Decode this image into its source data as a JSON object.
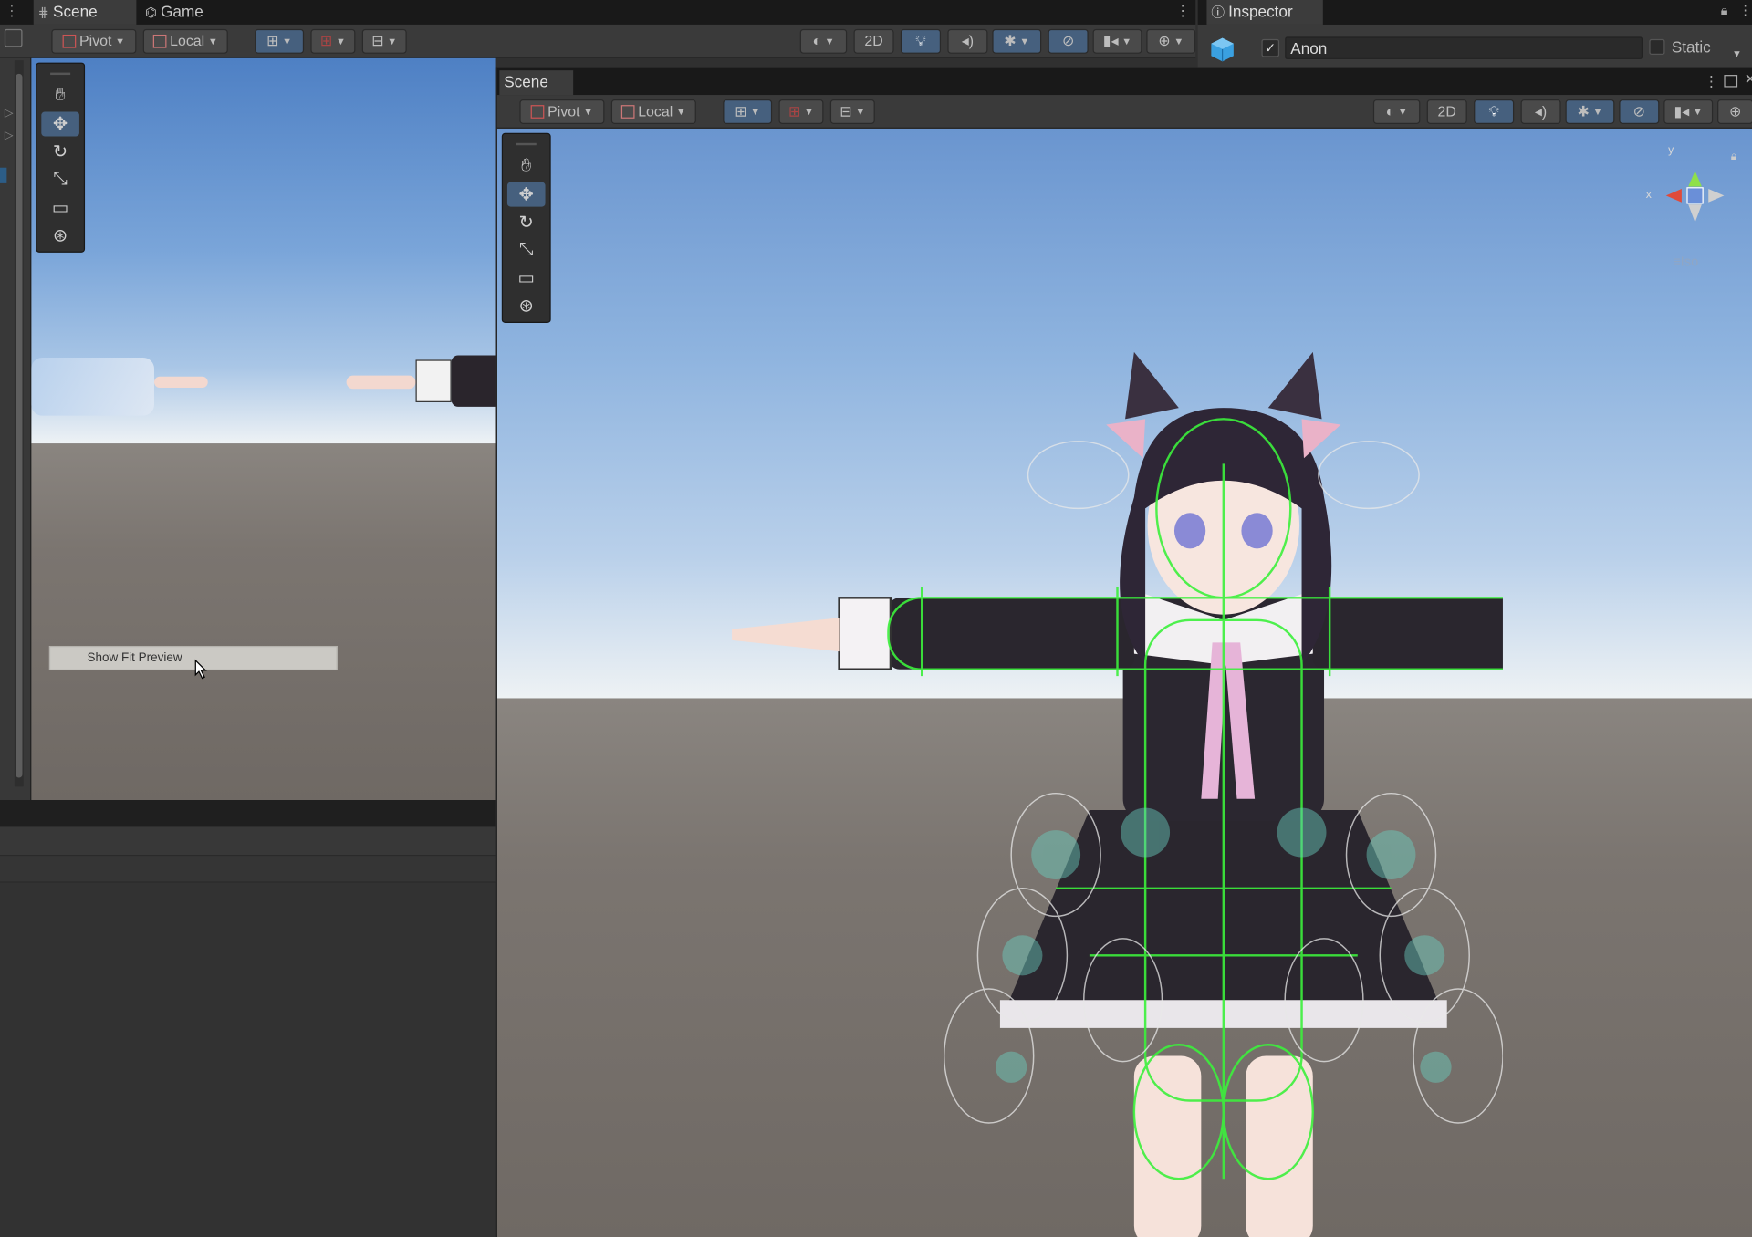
{
  "left_tabs": {
    "scene": "Scene",
    "game": "Game"
  },
  "inspector": {
    "tab": "Inspector",
    "object_name": "Anon",
    "static_label": "Static"
  },
  "left_toolbar": {
    "pivot": "Pivot",
    "local": "Local",
    "mode_2d": "2D"
  },
  "scene_window": {
    "tab": "Scene",
    "pivot": "Pivot",
    "local": "Local",
    "mode_2d": "2D"
  },
  "gizmo": {
    "x": "x",
    "y": "y",
    "projection": "Iso"
  },
  "context_menu": {
    "item": "Show Fit Preview"
  },
  "colors": {
    "accent": "#46607e",
    "panel": "#303030",
    "toolbar": "#3a3a3a",
    "collider": "#3cf03c"
  }
}
